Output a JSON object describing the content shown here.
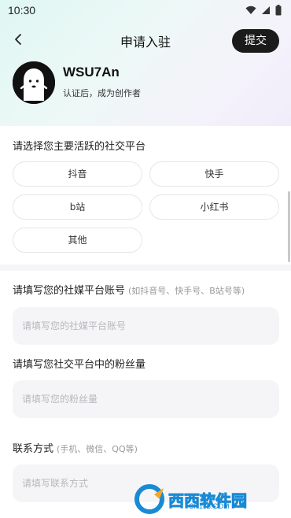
{
  "status_bar": {
    "time": "10:30"
  },
  "header": {
    "title": "申请入驻",
    "submit_label": "提交"
  },
  "profile": {
    "username": "WSU7An",
    "subtitle": "认证后，成为创作者"
  },
  "platform_section": {
    "title": "请选择您主要活跃的社交平台",
    "options": [
      "抖音",
      "快手",
      "b站",
      "小红书",
      "其他"
    ]
  },
  "account_section": {
    "title": "请填写您的社媒平台账号",
    "hint": "(如抖音号、快手号、B站号等)",
    "placeholder": "请填写您的社媒平台账号"
  },
  "fans_section": {
    "title": "请填写您社交平台中的粉丝量",
    "placeholder": "请填写您的粉丝量"
  },
  "contact_section": {
    "title": "联系方式",
    "hint": "(手机、微信、QQ等)",
    "placeholder": "请填写联系方式"
  },
  "watermark": {
    "text": "西西软件园",
    "url": "CR173.COM"
  },
  "icons": {
    "wifi": "wifi-icon",
    "signal": "signal-icon",
    "battery": "battery-icon",
    "back": "chevron-left-icon"
  }
}
